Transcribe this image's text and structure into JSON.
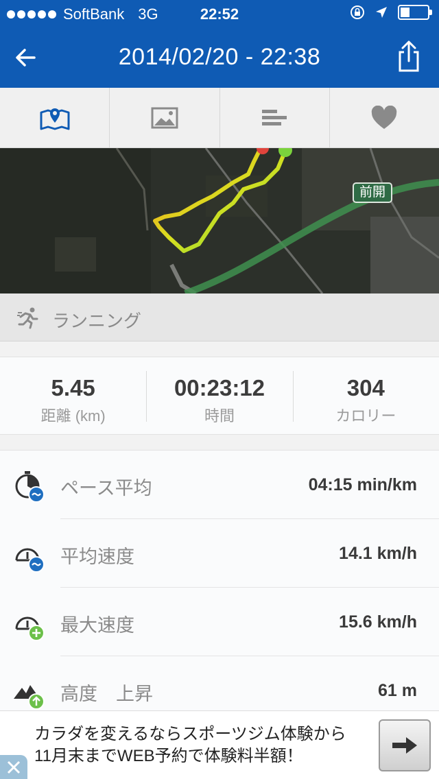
{
  "status_bar": {
    "carrier": "SoftBank",
    "network": "3G",
    "time": "22:52",
    "battery_level": 0.35
  },
  "header": {
    "title": "2014/02/20 - 22:38"
  },
  "tabs": [
    {
      "icon": "map-icon",
      "active": true
    },
    {
      "icon": "image-icon",
      "active": false
    },
    {
      "icon": "bar-list-icon",
      "active": false
    },
    {
      "icon": "heart-icon",
      "active": false
    }
  ],
  "map": {
    "route_label": "前開"
  },
  "activity": {
    "label": "ランニング"
  },
  "summary": {
    "distance": {
      "value": "5.45",
      "label": "距離 (km)"
    },
    "duration": {
      "value": "00:23:12",
      "label": "時間"
    },
    "calories": {
      "value": "304",
      "label": "カロリー"
    }
  },
  "details": [
    {
      "label": "ペース平均",
      "value": "04:15 min/km",
      "icon": "pace-average-icon"
    },
    {
      "label": "平均速度",
      "value": "14.1 km/h",
      "icon": "speed-average-icon"
    },
    {
      "label": "最大速度",
      "value": "15.6 km/h",
      "icon": "speed-max-icon"
    },
    {
      "label": "高度　上昇",
      "value": "61 m",
      "icon": "elevation-up-icon"
    }
  ],
  "ad": {
    "text": "カラダを変えるならスポーツジム体験から 11月末までWEB予約で体験料半額！"
  },
  "colors": {
    "header_blue": "#0f5bb4",
    "active_tab": "#0f5bb4",
    "icon_gray": "#8a8a8a",
    "badge_blue": "#1f6fc0",
    "badge_green": "#6cc04a"
  }
}
